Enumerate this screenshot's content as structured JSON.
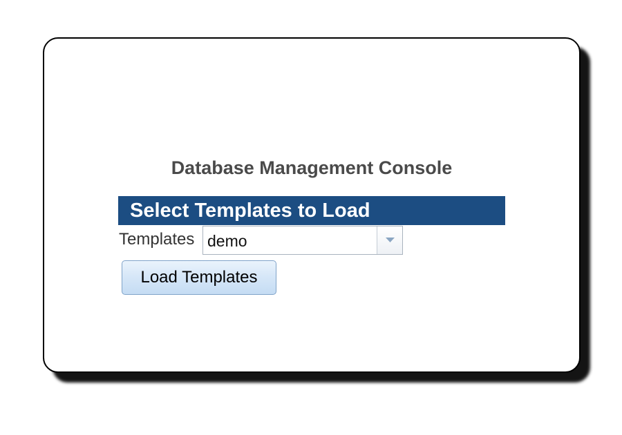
{
  "console": {
    "title": "Database Management Console"
  },
  "section": {
    "header": "Select Templates to Load"
  },
  "templates_field": {
    "label": "Templates",
    "selected_value": "demo"
  },
  "actions": {
    "load_label": "Load Templates"
  },
  "colors": {
    "header_background": "#1c4d82",
    "header_text": "#ffffff",
    "button_background": "#d3e5f7",
    "button_border": "#7fa3c9"
  },
  "icons": {
    "dropdown": "chevron-down-icon"
  }
}
